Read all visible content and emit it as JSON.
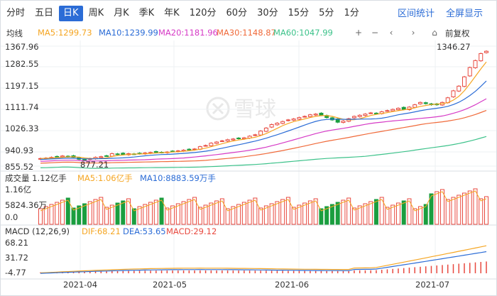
{
  "tabs": {
    "items": [
      "分时",
      "五日",
      "日K",
      "周K",
      "月K",
      "季K",
      "年K",
      "120分",
      "60分",
      "30分",
      "15分",
      "5分",
      "1分"
    ],
    "active": "日K",
    "right": [
      "区间统计",
      "全屏显示"
    ]
  },
  "toolbar": {
    "title": "均线",
    "ma": [
      {
        "label": "MA5:1299.73",
        "color": "#f5a623"
      },
      {
        "label": "MA10:1239.99",
        "color": "#2b6cd6"
      },
      {
        "label": "MA20:1181.96",
        "color": "#d63ac6"
      },
      {
        "label": "MA30:1148.87",
        "color": "#f06a3a"
      },
      {
        "label": "MA60:1047.99",
        "color": "#3cc28a"
      }
    ],
    "controls": [
      "+",
      "−",
      "‹",
      "›",
      "⌂"
    ],
    "adjust": "前复权"
  },
  "price_axis": [
    "1367.96",
    "1282.55",
    "1197.15",
    "1111.74",
    "1026.33",
    "940.93",
    "855.52"
  ],
  "price_annotations": {
    "high": "1346.27",
    "low": "877.21"
  },
  "volume": {
    "label": "成交量 1.12亿手",
    "ma5": "MA5:1.06亿手",
    "ma10": "MA10:8883.59万手",
    "axis": [
      "1.16亿",
      "5824.36万",
      "0.0"
    ]
  },
  "macd": {
    "label": "MACD (12,26,9)",
    "dif": "DIF:68.21",
    "dea": "DEA:53.65",
    "macd": "MACD:29.12",
    "axis": [
      "68.21",
      "31.72",
      "-4.77"
    ]
  },
  "dates": [
    "2021-04",
    "2021-05",
    "2021-06",
    "2021-07"
  ],
  "watermark": "雪球",
  "colors": {
    "up": "#e8493f",
    "down": "#1a9e3f",
    "accent": "#2b6cd6"
  },
  "chart_data": {
    "type": "candlestick",
    "x_labels": [
      "2021-04",
      "2021-05",
      "2021-06",
      "2021-07"
    ],
    "ylim": [
      855.52,
      1367.96
    ],
    "close_approx": [
      885,
      887,
      890,
      893,
      896,
      893,
      890,
      882,
      877,
      885,
      890,
      893,
      896,
      906,
      904,
      902,
      906,
      904,
      906,
      909,
      911,
      913,
      911,
      913,
      916,
      918,
      921,
      924,
      926,
      936,
      941,
      951,
      956,
      961,
      966,
      969,
      971,
      974,
      981,
      987,
      1003,
      1016,
      1031,
      1037,
      1044,
      1051,
      1055,
      1061,
      1066,
      1073,
      1076,
      1071,
      1061,
      1051,
      1041,
      1046,
      1056,
      1066,
      1071,
      1076,
      1081,
      1079,
      1086,
      1091,
      1096,
      1101,
      1096,
      1106,
      1116,
      1126,
      1121,
      1116,
      1116,
      1126,
      1146,
      1176,
      1196,
      1236,
      1276,
      1306,
      1336,
      1346
    ],
    "volume_axis": [
      "1.16亿",
      "5824.36万",
      "0.0"
    ],
    "macd_axis": [
      "68.21",
      "31.72",
      "-4.77"
    ]
  }
}
